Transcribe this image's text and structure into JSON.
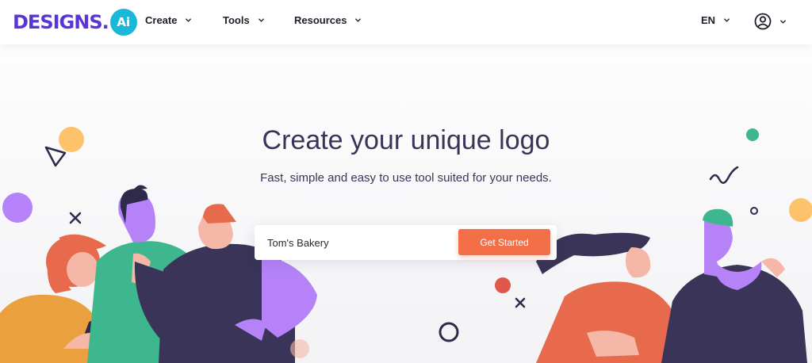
{
  "brand": {
    "name": "DESIGNS",
    "dot": ".",
    "badge": "Ai"
  },
  "nav": {
    "items": [
      {
        "label": "Create"
      },
      {
        "label": "Tools"
      },
      {
        "label": "Resources"
      }
    ],
    "language": "EN"
  },
  "hero": {
    "title": "Create your unique logo",
    "subtitle": "Fast, simple and easy to use tool suited for your needs.",
    "input_value": "Tom's Bakery",
    "cta_label": "Get Started"
  },
  "colors": {
    "brand_purple": "#5a35d6",
    "brand_cyan": "#19b8d8",
    "cta_orange": "#f26f47",
    "text_dark": "#3a3558"
  },
  "icons": [
    "chevron-down-icon",
    "user-circle-icon"
  ]
}
